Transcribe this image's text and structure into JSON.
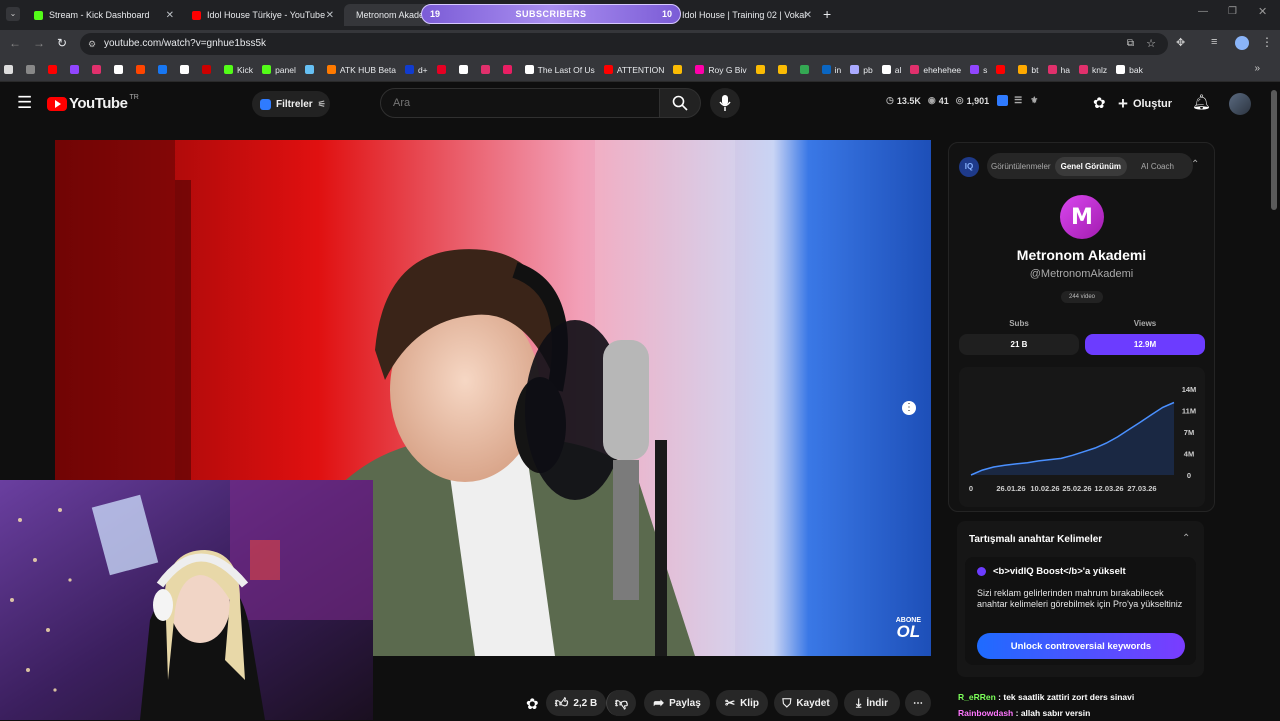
{
  "browser": {
    "tabs": [
      {
        "label": "Stream - Kick Dashboard",
        "color": "#53fc18"
      },
      {
        "label": "Idol House Türkiye - YouTube",
        "color": "#ff0000"
      },
      {
        "label": "Metronom Akademi",
        "color": "#ff0000"
      },
      {
        "label": "Idol House | Training 02 | Vokal",
        "color": "#ff0000"
      }
    ],
    "sub_overlay": {
      "left": "19",
      "title": "SUBSCRIBERS",
      "right": "10"
    },
    "url": "youtube.com/watch?v=gnhue1bss5k",
    "bookmarks": [
      {
        "label": "",
        "color": "#ff0000"
      },
      {
        "label": "",
        "color": "#9146ff"
      },
      {
        "label": "",
        "color": "#e1306c"
      },
      {
        "label": "",
        "color": "#ffffff"
      },
      {
        "label": "",
        "color": "#ff4500"
      },
      {
        "label": "",
        "color": "#1877f2"
      },
      {
        "label": "",
        "color": "#ffffff"
      },
      {
        "label": "",
        "color": "#c00"
      },
      {
        "label": "Kick",
        "color": "#53fc18"
      },
      {
        "label": "panel",
        "color": "#53fc18"
      },
      {
        "label": "",
        "color": "#66c0f4"
      },
      {
        "label": "ATK HUB Beta",
        "color": "#ff7a00"
      },
      {
        "label": "d+",
        "color": "#113ccf"
      },
      {
        "label": "",
        "color": "#e60023"
      },
      {
        "label": "",
        "color": "#ffffff"
      },
      {
        "label": "",
        "color": "#e1306c"
      },
      {
        "label": "",
        "color": "#e91e63"
      },
      {
        "label": "The Last Of Us",
        "color": "#ffffff"
      },
      {
        "label": "ATTENTION",
        "color": "#ff0000"
      },
      {
        "label": "",
        "color": "#fbbc04"
      },
      {
        "label": "Roy G Biv",
        "color": "#ff00aa"
      },
      {
        "label": "",
        "color": "#fbbc04"
      },
      {
        "label": "",
        "color": "#fbbc04"
      },
      {
        "label": "",
        "color": "#34a853"
      },
      {
        "label": "in",
        "color": "#0a66c2"
      },
      {
        "label": "pb",
        "color": "#aaaaff"
      },
      {
        "label": "al",
        "color": "#ffffff"
      },
      {
        "label": "ehehehee",
        "color": "#e1306c"
      },
      {
        "label": "s",
        "color": "#9146ff"
      },
      {
        "label": "",
        "color": "#ff0000"
      },
      {
        "label": "bt",
        "color": "#ffaa00"
      },
      {
        "label": "ha",
        "color": "#e1306c"
      },
      {
        "label": "knlz",
        "color": "#e1306c"
      },
      {
        "label": "bak",
        "color": "#ffffff"
      }
    ]
  },
  "youtube": {
    "logo_text": "YouTube",
    "logo_region": "TR",
    "filters_label": "Filtreler",
    "search_placeholder": "Ara",
    "stats": {
      "views": "13.5K",
      "likes": "41",
      "comments": "1,901"
    },
    "create_label": "Oluştur"
  },
  "video": {
    "watermark_line1": "ABONE",
    "watermark_line2": "OL"
  },
  "actions": {
    "likes": "2,2 B",
    "share": "Paylaş",
    "clip": "Klip",
    "save": "Kaydet",
    "download": "İndir"
  },
  "vidiq": {
    "tabs": [
      "Görüntülenmeler",
      "Genel Görünüm",
      "AI Coach"
    ],
    "active_tab": "Genel Görünüm",
    "channel_name": "Metronom Akademi",
    "channel_handle": "@MetronomAkademi",
    "video_count": "244 video",
    "subs_label": "Subs",
    "views_label": "Views",
    "subs_value": "21 B",
    "views_value": "12.9M",
    "accent": "#6c3cff"
  },
  "chart_data": {
    "type": "area",
    "x": [
      "26.01.26",
      "10.02.26",
      "25.02.26",
      "12.03.26",
      "27.03.26"
    ],
    "x_leading_tick": "0",
    "y_ticks": [
      "14M",
      "11M",
      "7M",
      "4M",
      "0"
    ],
    "ylim": [
      0,
      14
    ],
    "series": [
      {
        "values": [
          0.0,
          0.8,
          1.3,
          1.6,
          1.8,
          2.0,
          2.3,
          2.5,
          2.7,
          3.2,
          3.8,
          4.4,
          5.2,
          6.2,
          7.4,
          8.6,
          9.8,
          11.0,
          11.8
        ]
      }
    ],
    "grid": false
  },
  "keywords": {
    "title": "Tartışmalı anahtar Kelimeler",
    "upgrade_title": "<b>vidIQ Boost</b>'a yükselt",
    "upgrade_body": "Sizi reklam gelirlerinden mahrum bırakabilecek anahtar kelimeleri görebilmek için Pro'ya yükseltiniz",
    "unlock_label": "Unlock controversial keywords"
  },
  "chat": [
    {
      "user": "R_eRRen",
      "text": "tek saatlik zattiri zort ders sinavi",
      "color": "#7cff5a"
    },
    {
      "user": "Rainbowdash",
      "text": "allah sabır versin",
      "color": "#ff77ff"
    }
  ]
}
